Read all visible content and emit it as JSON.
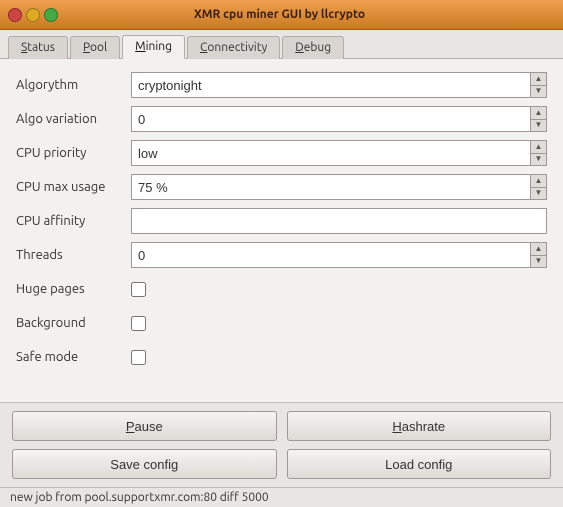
{
  "titleBar": {
    "title": "XMR cpu miner GUI by llcrypto",
    "buttons": {
      "close": "×",
      "minimize": "−",
      "maximize": "+"
    }
  },
  "tabs": [
    {
      "id": "status",
      "label": "Status",
      "underline": "S",
      "active": false
    },
    {
      "id": "pool",
      "label": "Pool",
      "underline": "P",
      "active": false
    },
    {
      "id": "mining",
      "label": "Mining",
      "underline": "M",
      "active": true
    },
    {
      "id": "connectivity",
      "label": "Connectivity",
      "underline": "C",
      "active": false
    },
    {
      "id": "debug",
      "label": "Debug",
      "underline": "D",
      "active": false
    }
  ],
  "form": {
    "algorythm": {
      "label": "Algorythm",
      "value": "cryptonight"
    },
    "algoVariation": {
      "label": "Algo variation",
      "value": "0"
    },
    "cpuPriority": {
      "label": "CPU priority",
      "value": "low"
    },
    "cpuMaxUsage": {
      "label": "CPU max usage",
      "value": "75 %"
    },
    "cpuAffinity": {
      "label": "CPU affinity",
      "value": ""
    },
    "threads": {
      "label": "Threads",
      "value": "0"
    },
    "hugePages": {
      "label": "Huge pages",
      "checked": false
    },
    "background": {
      "label": "Background",
      "checked": false
    },
    "safeMode": {
      "label": "Safe mode",
      "checked": false
    }
  },
  "buttons": {
    "pause": "Pause",
    "hashrate": "Hashrate",
    "saveConfig": "Save config",
    "loadConfig": "Load config"
  },
  "statusBar": {
    "text": "new job from pool.supportxmr.com:80 diff 5000"
  }
}
